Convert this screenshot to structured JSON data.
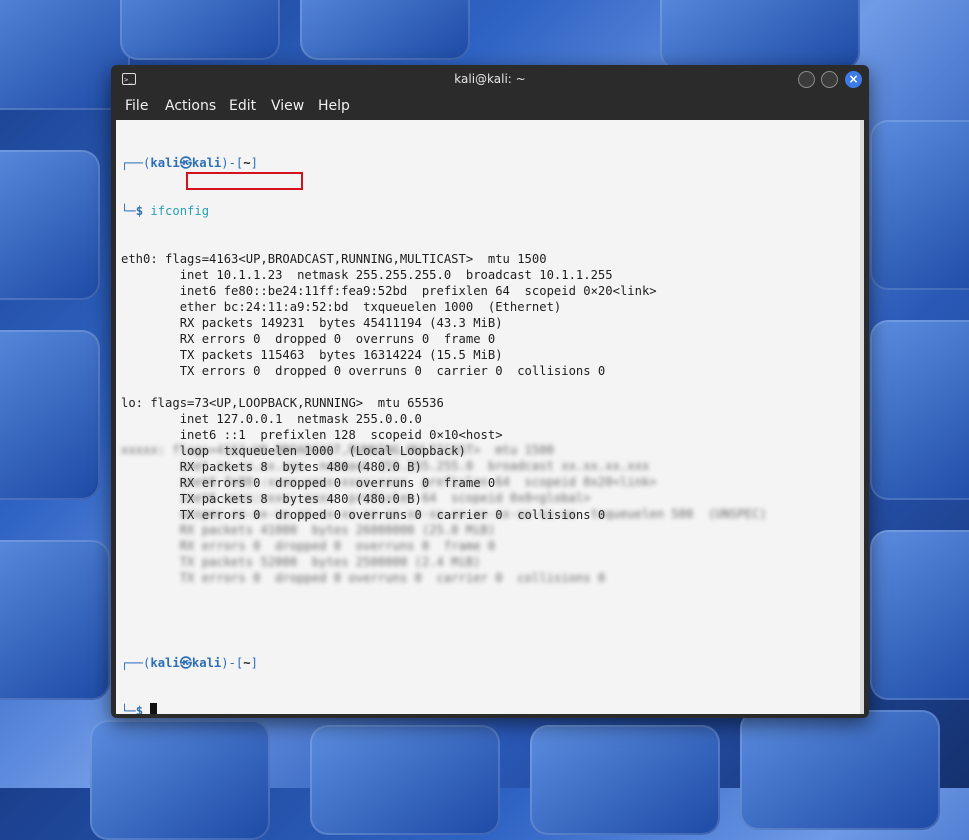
{
  "window": {
    "title": "kali@kali: ~",
    "close_glyph": "×"
  },
  "menu": [
    "File",
    "Actions",
    "Edit",
    "View",
    "Help"
  ],
  "prompt": {
    "frame_top": "┌──(",
    "user_host": "kali㉿kali",
    "path_open": ")-[",
    "path": "~",
    "path_close": "]",
    "frame_bottom": "└─",
    "dollar": "$ "
  },
  "command": "ifconfig",
  "output_lines": [
    "eth0: flags=4163<UP,BROADCAST,RUNNING,MULTICAST>  mtu 1500",
    "        inet 10.1.1.23  netmask 255.255.255.0  broadcast 10.1.1.255",
    "        inet6 fe80::be24:11ff:fea9:52bd  prefixlen 64  scopeid 0×20<link>",
    "        ether bc:24:11:a9:52:bd  txqueuelen 1000  (Ethernet)",
    "        RX packets 149231  bytes 45411194 (43.3 MiB)",
    "        RX errors 0  dropped 0  overruns 0  frame 0",
    "        TX packets 115463  bytes 16314224 (15.5 MiB)",
    "        TX errors 0  dropped 0 overruns 0  carrier 0  collisions 0",
    "",
    "lo: flags=73<UP,LOOPBACK,RUNNING>  mtu 65536",
    "        inet 127.0.0.1  netmask 255.0.0.0",
    "        inet6 ::1  prefixlen 128  scopeid 0×10<host>",
    "        loop  txqueuelen 1000  (Local Loopback)",
    "        RX packets 8  bytes 480 (480.0 B)",
    "        RX errors 0  dropped 0  overruns 0  frame 0",
    "        TX packets 8  bytes 480 (480.0 B)",
    "        TX errors 0  dropped 0 overruns 0  carrier 0  collisions 0"
  ],
  "icons": {
    "terminal": "terminal-icon",
    "minimize": "minimize-icon",
    "maximize": "maximize-icon",
    "close": "close-icon"
  },
  "colors": {
    "highlight_box": "#d4121e",
    "prompt_blue": "#2d6fb7",
    "command_cyan": "#2aa1b3",
    "close_button": "#3d7ce8"
  }
}
